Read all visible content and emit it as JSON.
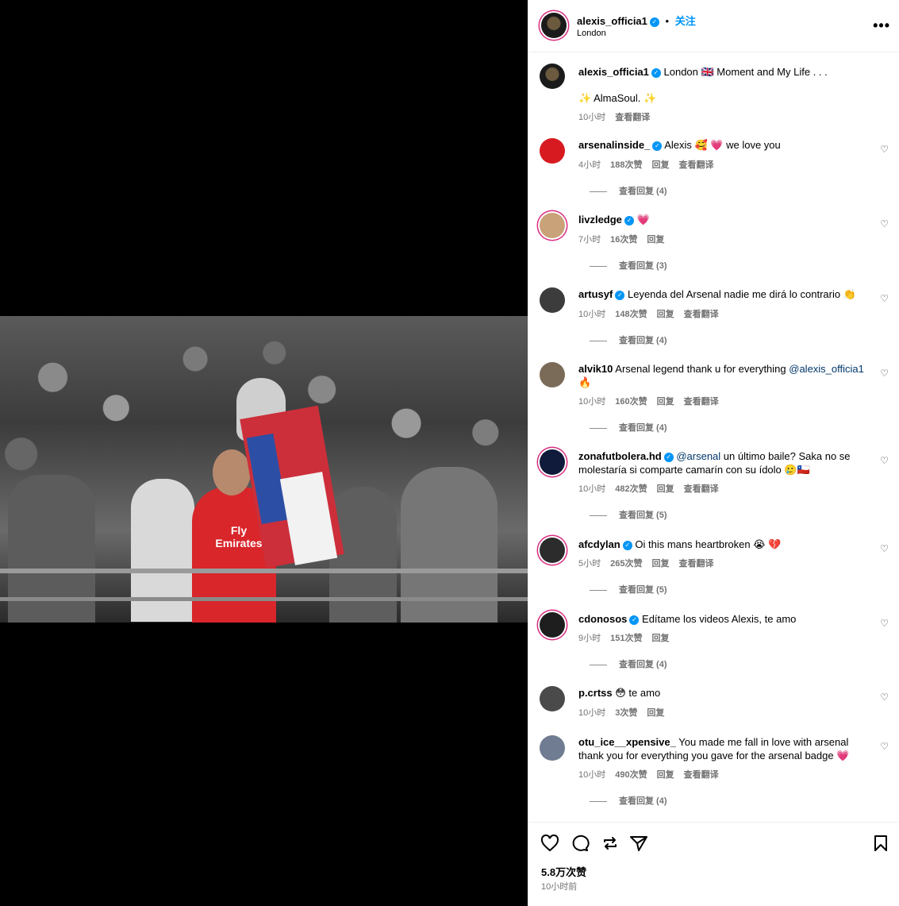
{
  "post": {
    "author": "alexis_officia1",
    "follow_label": "关注",
    "location": "London",
    "dot": "•",
    "more": "•••"
  },
  "media": {
    "shirt_text": "Fly Emirates"
  },
  "caption": {
    "username": "alexis_officia1",
    "line1": "London 🇬🇧 Moment and My Life . . .",
    "line2": "✨ AlmaSoul. ✨",
    "time": "10小时",
    "translate": "查看翻译"
  },
  "comments": [
    {
      "user": "arsenalinside_",
      "verified": true,
      "text": "Alexis 🥰 💗 we love you",
      "time": "4小时",
      "likes": "188次赞",
      "reply": "回复",
      "translate": "查看翻译",
      "view_replies": "查看回复 (4)"
    },
    {
      "user": "livzledge",
      "verified": true,
      "text": "💗",
      "time": "7小时",
      "likes": "16次赞",
      "reply": "回复",
      "translate": "",
      "view_replies": "查看回复 (3)"
    },
    {
      "user": "artusyf",
      "verified": true,
      "text": "Leyenda del Arsenal nadie me dirá lo contrario 👏",
      "time": "10小时",
      "likes": "148次赞",
      "reply": "回复",
      "translate": "查看翻译",
      "view_replies": "查看回复 (4)"
    },
    {
      "user": "alvik10",
      "verified": false,
      "text": "Arsenal legend thank u for everything ",
      "mention": "@alexis_officia1",
      "text2": " 🔥",
      "time": "10小时",
      "likes": "160次赞",
      "reply": "回复",
      "translate": "查看翻译",
      "view_replies": "查看回复 (4)"
    },
    {
      "user": "zonafutbolera.hd",
      "verified": true,
      "mention": "@arsenal",
      "text": " un último baile? Saka no se molestaría si comparte camarín con su ídolo 🥲🇨🇱",
      "time": "10小时",
      "likes": "482次赞",
      "reply": "回复",
      "translate": "查看翻译",
      "view_replies": "查看回复 (5)"
    },
    {
      "user": "afcdylan",
      "verified": true,
      "text": "Oi this mans heartbroken 😭 💔",
      "time": "5小时",
      "likes": "265次赞",
      "reply": "回复",
      "translate": "查看翻译",
      "view_replies": "查看回复 (5)"
    },
    {
      "user": "cdonosos",
      "verified": true,
      "text": "Edítame los videos Alexis, te amo",
      "time": "9小时",
      "likes": "151次赞",
      "reply": "回复",
      "translate": "",
      "view_replies": "查看回复 (4)"
    },
    {
      "user": "p.crtss",
      "verified": false,
      "text": "😳 te amo",
      "time": "10小时",
      "likes": "3次赞",
      "reply": "回复",
      "translate": "",
      "view_replies": ""
    },
    {
      "user": "otu_ice__xpensive_",
      "verified": false,
      "text": "You made me fall in love with arsenal thank you for everything you gave for the arsenal badge 💗",
      "time": "10小时",
      "likes": "490次赞",
      "reply": "回复",
      "translate": "查看翻译",
      "view_replies": "查看回复 (4)"
    }
  ],
  "footer": {
    "likes": "5.8万次赞",
    "posted": "10小时前"
  },
  "icons": [
    "heart-icon",
    "comment-icon",
    "share-icon",
    "send-icon",
    "bookmark-icon",
    "more-icon",
    "verified-icon"
  ],
  "colors": {
    "accent": "#0095f6",
    "meta": "#737373",
    "story_ring": "#d92e7f"
  }
}
